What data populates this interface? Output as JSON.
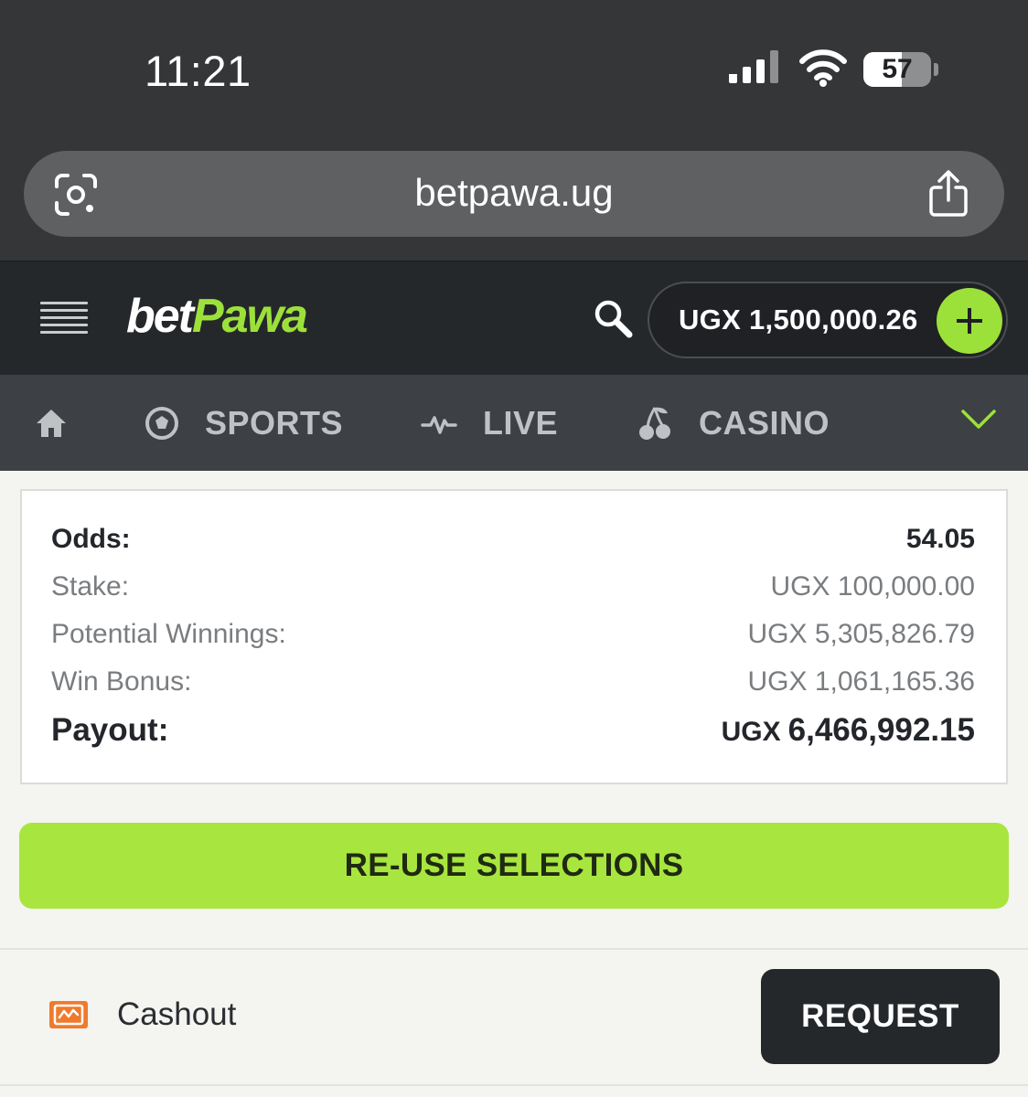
{
  "status_bar": {
    "time": "11:21",
    "battery": "57"
  },
  "browser": {
    "url": "betpawa.ug"
  },
  "header": {
    "logo_bet": "bet",
    "logo_pawa": "Pawa",
    "balance": "UGX 1,500,000.26"
  },
  "nav": {
    "items": [
      {
        "label": "SPORTS"
      },
      {
        "label": "LIVE"
      },
      {
        "label": "CASINO"
      }
    ]
  },
  "summary": {
    "odds_label": "Odds:",
    "odds_value": "54.05",
    "stake_label": "Stake:",
    "stake_value": "UGX 100,000.00",
    "potential_label": "Potential Winnings:",
    "potential_value": "UGX 5,305,826.79",
    "bonus_label": "Win Bonus:",
    "bonus_value": "UGX 1,061,165.36",
    "payout_label": "Payout:",
    "payout_currency": "UGX",
    "payout_value": "6,466,992.15"
  },
  "actions": {
    "reuse_label": "RE-USE SELECTIONS",
    "cashout_label": "Cashout",
    "request_label": "REQUEST"
  },
  "colors": {
    "accent": "#9ce13a",
    "button_green": "#a8e63f",
    "header_bg": "#25282b",
    "nav_bg": "#3d4044",
    "cashout_icon": "#f07a2c"
  }
}
